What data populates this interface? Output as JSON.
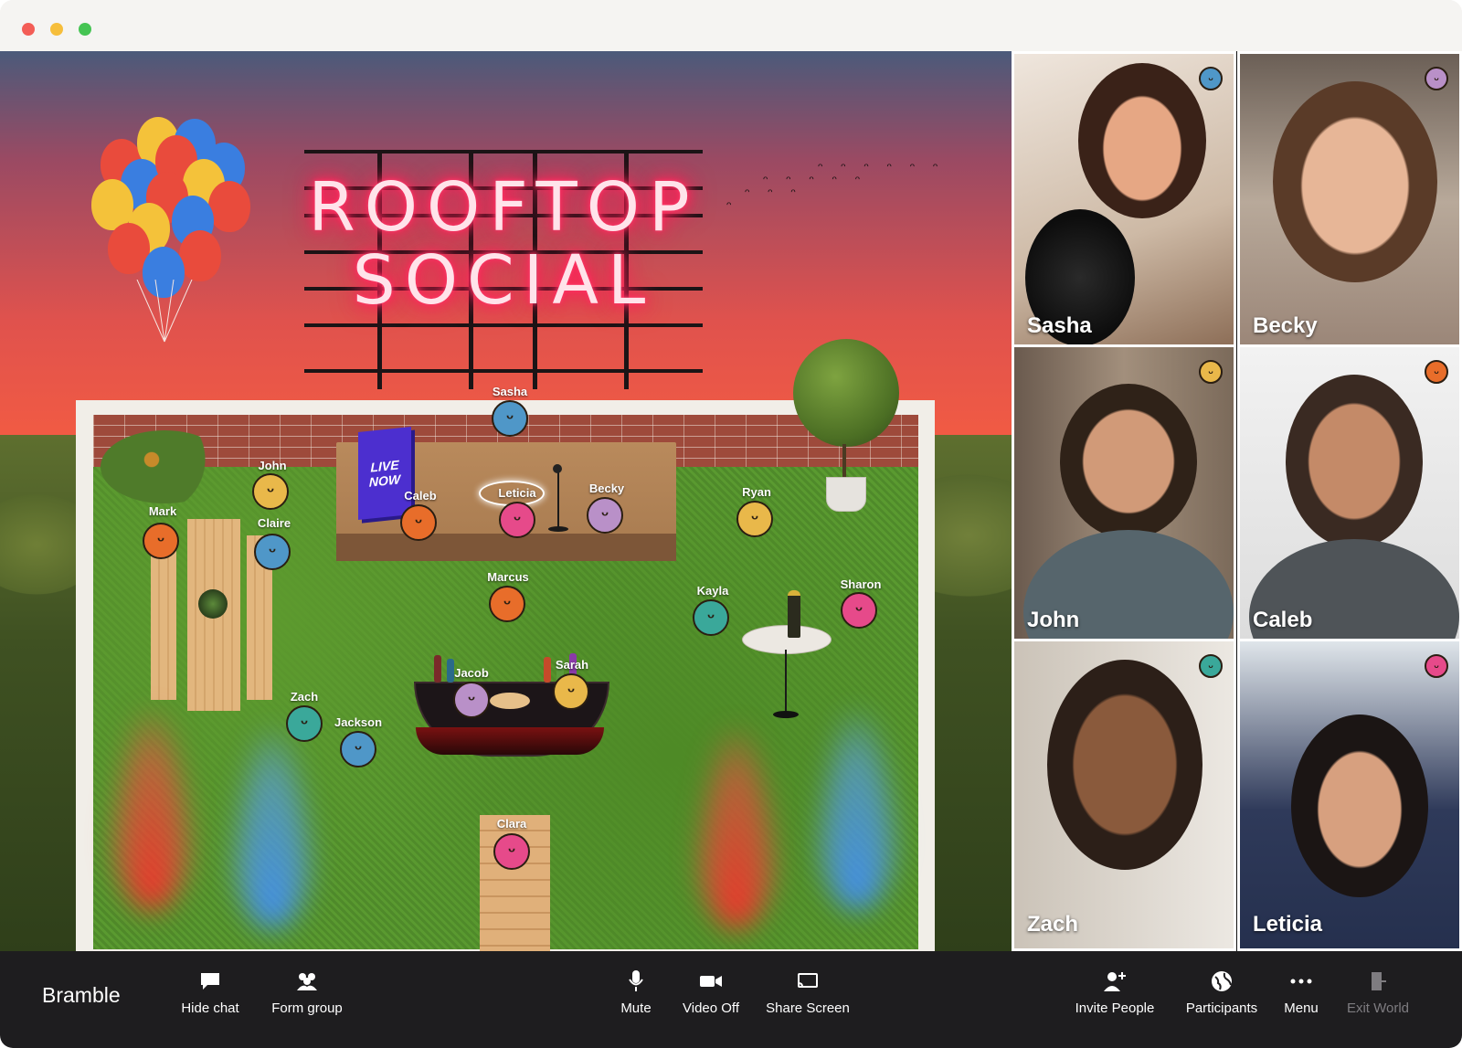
{
  "world": {
    "sign_line1": "ROOFTOP",
    "sign_line2": "SOCIAL",
    "stage_sign_line1": "LIVE",
    "stage_sign_line2": "NOW",
    "avatars": [
      {
        "name": "Sasha",
        "color": "#4f97c8",
        "face": "ᵕ"
      },
      {
        "name": "John",
        "color": "#e9b84a",
        "face": "ᵕ"
      },
      {
        "name": "Mark",
        "color": "#e86d2a",
        "face": "ᵕ"
      },
      {
        "name": "Claire",
        "color": "#4f97c8",
        "face": "ᵕ"
      },
      {
        "name": "Caleb",
        "color": "#e86d2a",
        "face": "ᵕ"
      },
      {
        "name": "Leticia",
        "color": "#e64a8a",
        "face": "ᵕ"
      },
      {
        "name": "Becky",
        "color": "#b990c8",
        "face": "ᵕ"
      },
      {
        "name": "Ryan",
        "color": "#e9b84a",
        "face": "ᵕ"
      },
      {
        "name": "Marcus",
        "color": "#e86d2a",
        "face": "ᵕ"
      },
      {
        "name": "Kayla",
        "color": "#3aa89a",
        "face": "ᵕ"
      },
      {
        "name": "Sharon",
        "color": "#e64a8a",
        "face": "ᵕ"
      },
      {
        "name": "Jacob",
        "color": "#b990c8",
        "face": "ᵕ"
      },
      {
        "name": "Sarah",
        "color": "#e9b84a",
        "face": "ᵕ"
      },
      {
        "name": "Zach",
        "color": "#3aa89a",
        "face": "ᵕ"
      },
      {
        "name": "Jackson",
        "color": "#4f97c8",
        "face": "ᵕ"
      },
      {
        "name": "Clara",
        "color": "#e64a8a",
        "face": "ᵕ"
      }
    ]
  },
  "video_tiles": [
    {
      "name": "Sasha",
      "badge_color": "#4f97c8"
    },
    {
      "name": "Becky",
      "badge_color": "#b990c8"
    },
    {
      "name": "John",
      "badge_color": "#e9b84a"
    },
    {
      "name": "Caleb",
      "badge_color": "#e86d2a"
    },
    {
      "name": "Zach",
      "badge_color": "#3aa89a"
    },
    {
      "name": "Leticia",
      "badge_color": "#e64a8a"
    }
  ],
  "toolbar": {
    "brand": "Bramble",
    "hide_chat": "Hide chat",
    "form_group": "Form group",
    "mute": "Mute",
    "video_off": "Video Off",
    "share_screen": "Share Screen",
    "invite_people": "Invite People",
    "participants": "Participants",
    "menu": "Menu",
    "exit_world": "Exit World"
  },
  "colors": {
    "close": "#f35d56",
    "minimize": "#f6be3b",
    "zoom": "#45c453",
    "toolbar_bg": "#1e1d1f"
  }
}
